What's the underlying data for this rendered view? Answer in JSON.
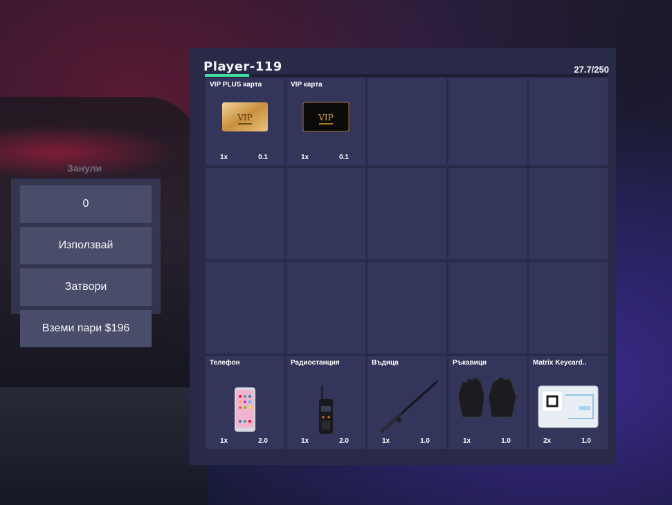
{
  "background": {
    "label": "Занули"
  },
  "action_menu": {
    "amount": "0",
    "use": "Използвай",
    "close": "Затвори",
    "take_money": "Вземи пари $196"
  },
  "inventory": {
    "title": "Player-119",
    "weight": "27.7/250",
    "weight_fraction": 0.1108,
    "top_row": [
      {
        "name": "VIP PLUS карта",
        "qty": "1x",
        "weight": "0.1",
        "icon": "vip-plus-card-icon"
      },
      {
        "name": "VIP карта",
        "qty": "1x",
        "weight": "0.1",
        "icon": "vip-card-icon"
      }
    ],
    "bottom_row": [
      {
        "name": "Телефон",
        "qty": "1x",
        "weight": "2.0",
        "icon": "phone-icon"
      },
      {
        "name": "Радиостанция",
        "qty": "1x",
        "weight": "2.0",
        "icon": "radio-icon"
      },
      {
        "name": "Въдица",
        "qty": "1x",
        "weight": "1.0",
        "icon": "fishing-rod-icon"
      },
      {
        "name": "Ръкавици",
        "qty": "1x",
        "weight": "1.0",
        "icon": "gloves-icon"
      },
      {
        "name": "Matrix Keycard..",
        "qty": "2x",
        "weight": "1.0",
        "icon": "keycard-icon"
      }
    ]
  },
  "colors": {
    "panel": "#282a48",
    "slot": "#33355a",
    "button": "#4a4d6a",
    "weight_bar": "#3fdf9f"
  }
}
